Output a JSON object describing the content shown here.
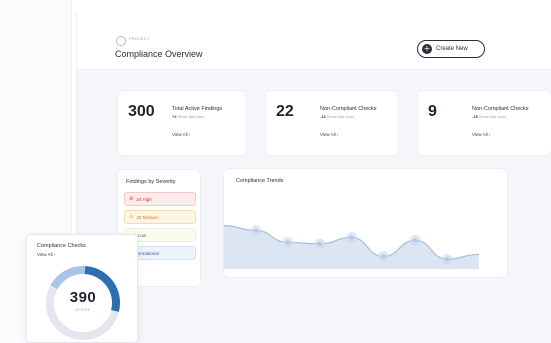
{
  "header": {
    "project_label": "PROJECT",
    "title": "Compliance Overview",
    "create_button": "Create New"
  },
  "stats": [
    {
      "value": "300",
      "title": "Total Active Findings",
      "delta": "+2",
      "delta_note": "Since last scan",
      "link": "View All ›"
    },
    {
      "value": "22",
      "title": "Non-Compliant Checks",
      "delta": "-16",
      "delta_note": "Since last scan",
      "link": "View All ›"
    },
    {
      "value": "9",
      "title": "Non-Compliant Checks",
      "delta": "-15",
      "delta_note": "Since last scan",
      "link": "View All ›"
    }
  ],
  "severity": {
    "title": "Findings by Severity",
    "items": [
      {
        "label": "24 High",
        "icon": "alert-circle-icon",
        "bg": "#fdecec",
        "border": "#f6c9c9",
        "color": "#c0392b"
      },
      {
        "label": "30 Medium",
        "icon": "warning-triangle-icon",
        "bg": "#fff4e5",
        "border": "#f7dcb0",
        "color": "#d4850f"
      },
      {
        "label": "100 Low",
        "icon": "",
        "bg": "#fbfbf0",
        "border": "#eeeed8",
        "color": "#6b6b40"
      },
      {
        "label": "3 Informational",
        "icon": "",
        "bg": "#eef3fb",
        "border": "#d5e0f3",
        "color": "#3b5a8f"
      }
    ]
  },
  "trends": {
    "title": "Compliance Trends"
  },
  "trend_series": [
    0.62,
    0.55,
    0.38,
    0.36,
    0.45,
    0.18,
    0.41,
    0.14,
    0.21
  ],
  "compliance_checks": {
    "title": "Compliance Checks",
    "link": "View All ›",
    "score": "390",
    "score_label": "SCORE"
  },
  "colors": {
    "accent": "#2f6fb0",
    "accent_light": "#a9c4e4",
    "track": "#e4e7ed",
    "trend_fill": "#dce6f3",
    "trend_line": "#a6bedd"
  }
}
